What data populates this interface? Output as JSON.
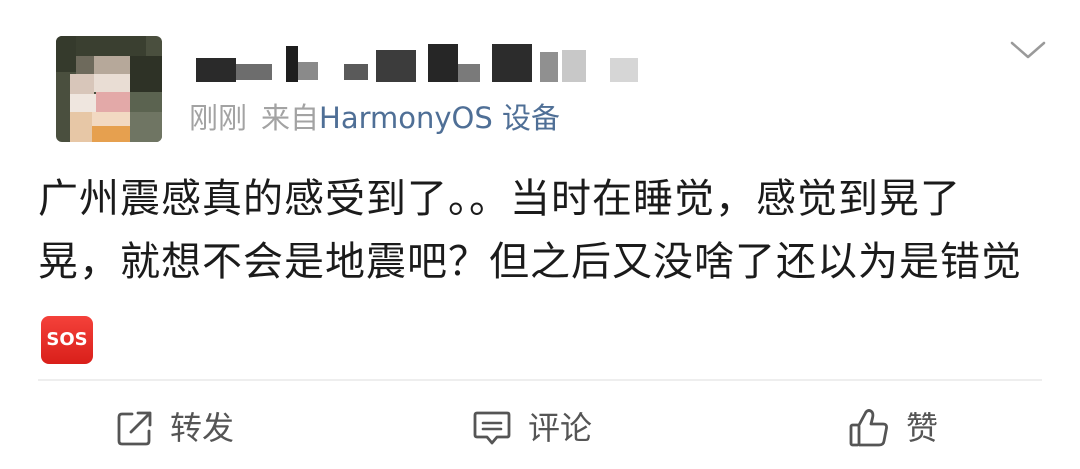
{
  "post": {
    "time": "刚刚",
    "source_prefix": "来自",
    "source_device": "HarmonyOS 设备",
    "text_main": "广州震感真的感受到了。。当时在睡觉，感觉到晃了晃，就想不会是地震吧？但之后又没啥了还以为是错觉",
    "emoji": "SOS"
  },
  "actions": {
    "repost_label": "转发",
    "comment_label": "评论",
    "like_label": "赞"
  },
  "icons": {
    "menu": "chevron-down-icon",
    "repost": "repost-icon",
    "comment": "comment-icon",
    "like": "thumbs-up-icon",
    "emoji": "sos-emoji"
  },
  "colors": {
    "source_link": "#4f6f96",
    "meta_text": "#a3a3a3",
    "body_text": "#1b1b1b",
    "action_text": "#555555",
    "sos_red": "#e5302b"
  }
}
